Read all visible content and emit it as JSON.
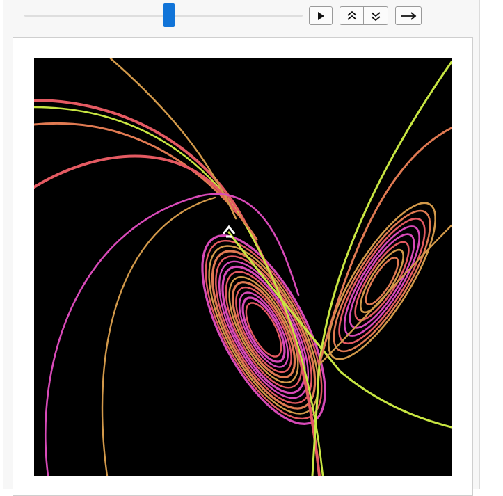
{
  "controls": {
    "slider": {
      "value": 0.52
    },
    "play_button": {
      "icon": "play-icon"
    },
    "faster_button": {
      "icon": "double-chevron-up-icon"
    },
    "slower_button": {
      "icon": "double-chevron-down-icon"
    },
    "direction_button": {
      "icon": "arrow-right-icon"
    }
  },
  "plot": {
    "background": "#000000",
    "colors": {
      "magenta": "#d84ab8",
      "salmon": "#e45a62",
      "gold": "#d2994a",
      "lime": "#c8e642",
      "orange": "#e07a52"
    },
    "marker": {
      "color": "#ffffff"
    }
  }
}
